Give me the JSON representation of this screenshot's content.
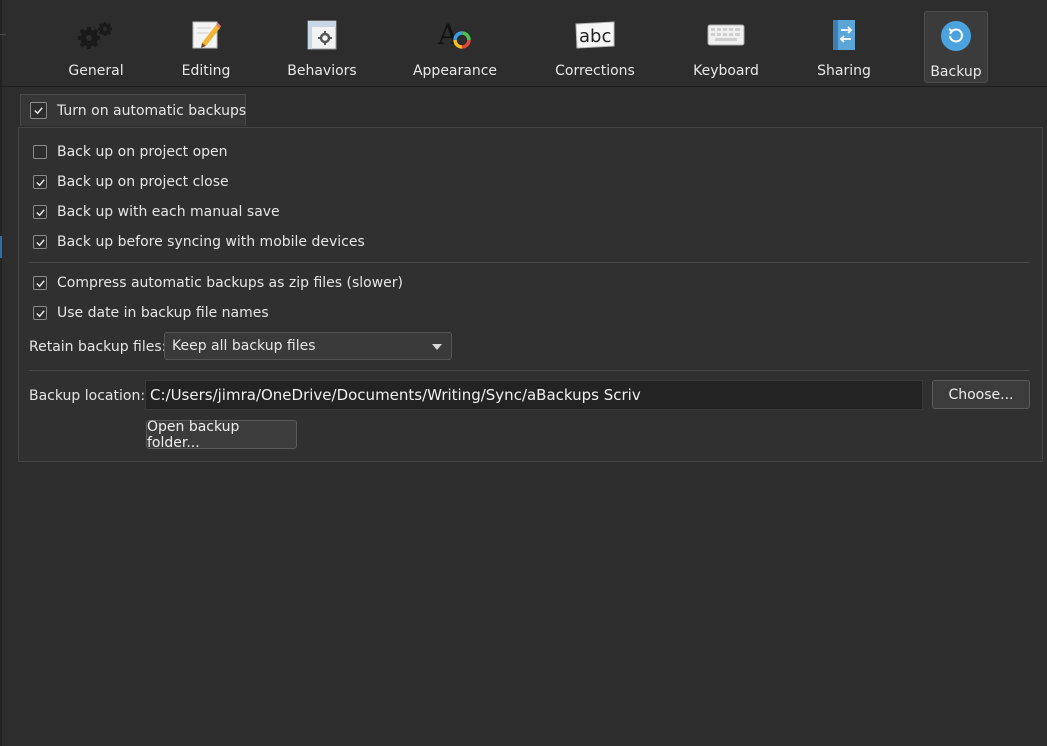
{
  "toolbar": {
    "tabs": [
      {
        "id": "general",
        "label": "General",
        "icon": "gears-icon"
      },
      {
        "id": "editing",
        "label": "Editing",
        "icon": "pencil-icon"
      },
      {
        "id": "behaviors",
        "label": "Behaviors",
        "icon": "window-gear-icon"
      },
      {
        "id": "appearance",
        "label": "Appearance",
        "icon": "font-color-wheel-icon"
      },
      {
        "id": "corrections",
        "label": "Corrections",
        "icon": "abc-icon"
      },
      {
        "id": "keyboard",
        "label": "Keyboard",
        "icon": "keyboard-icon"
      },
      {
        "id": "sharing",
        "label": "Sharing",
        "icon": "sync-arrows-icon"
      },
      {
        "id": "backup",
        "label": "Backup",
        "icon": "backup-circle-icon"
      }
    ],
    "active": "backup"
  },
  "backup": {
    "enable_label": "Turn on automatic backups",
    "enable_checked": true,
    "options": [
      {
        "label": "Back up on project open",
        "checked": false
      },
      {
        "label": "Back up on project close",
        "checked": true
      },
      {
        "label": "Back up with each manual save",
        "checked": true
      },
      {
        "label": "Back up before syncing with mobile devices",
        "checked": true
      }
    ],
    "compress_label": "Compress automatic backups as zip files (slower)",
    "compress_checked": true,
    "date_label": "Use date in backup file names",
    "date_checked": true,
    "retain_label": "Retain backup files:",
    "retain_value": "Keep all backup files",
    "location_label": "Backup location:",
    "location_value": "C:/Users/jimra/OneDrive/Documents/Writing/Sync/aBackups Scriv",
    "choose_label": "Choose...",
    "open_folder_label": "Open backup folder..."
  },
  "colors": {
    "background": "#2d2d2d",
    "accent": "#4aa3df",
    "text": "#e6e6e6"
  }
}
